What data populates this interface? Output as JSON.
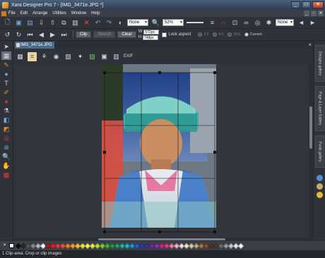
{
  "window": {
    "title": "Xara Designer Pro 7 - [IMG_3471e.JPG *]"
  },
  "menu": {
    "items": [
      "File",
      "Edit",
      "Arrange",
      "Utilities",
      "Window",
      "Help"
    ]
  },
  "toolbar1": {
    "fill_dropdown": "None",
    "zoom_dropdown": "52%",
    "arrow_dropdown": "None"
  },
  "toolbar2": {
    "clip_label": "Clip",
    "stretch_label": "Stretch",
    "clear_label": "Clear",
    "width_label": "W",
    "height_label": "H",
    "width_value": "572px",
    "height_value": "748px",
    "lock_aspect_label": "Lock aspect",
    "aspect_options": [
      "3:2",
      "4:3",
      "16:9",
      "Current"
    ],
    "aspect_selected": "Current"
  },
  "document_tab": {
    "label": "IMG_3471e.JPG *"
  },
  "infobar": {
    "exif_label": "EXIF"
  },
  "photo": {
    "frame_colors": {
      "sky": "#3b5f9e",
      "hat": "#3fb0a8",
      "face": "#c98e62",
      "shirt": "#d9dde4",
      "fg": "#8fc6c4"
    }
  },
  "galleries": [
    "Designs gallery",
    "Page & Layer Gallery",
    "Fonts gallery"
  ],
  "palette": {
    "colors": [
      "#111111",
      "#2a2a2a",
      "#555555",
      "#888888",
      "#b8b8b8",
      "#ffffff",
      "#b01818",
      "#e02020",
      "#e03850",
      "#e85a1a",
      "#f07f20",
      "#f49c2a",
      "#f4c24a",
      "#f6e43a",
      "#f8f06a",
      "#e8f046",
      "#b8e040",
      "#7ccc2e",
      "#3cb43c",
      "#1c9a48",
      "#1aa070",
      "#20b49a",
      "#22b4c8",
      "#2090d8",
      "#2060c8",
      "#2a3ea8",
      "#4a2aa0",
      "#7a2aa8",
      "#a02ab0",
      "#c82a9a",
      "#e03a8a",
      "#f07aa8",
      "#f4b4c8",
      "#f8d8d8",
      "#e8e8d0",
      "#d8c8a8",
      "#c8a878",
      "#a8784a",
      "#885030",
      "#603018",
      "#4a3a30",
      "#6a6a6a",
      "#9a9a9a",
      "#c8c8c8",
      "#e8e8e8",
      "#ffffff"
    ]
  },
  "status": {
    "text": "1 Clip-area: Crop or clip images"
  }
}
